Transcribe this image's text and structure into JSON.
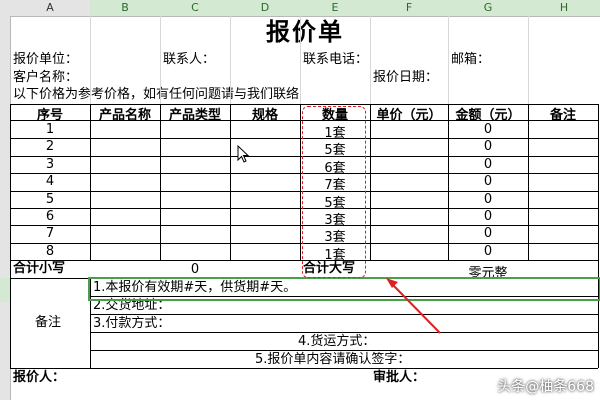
{
  "columns": [
    "A",
    "B",
    "C",
    "D",
    "E",
    "F",
    "G",
    "H"
  ],
  "title": "报价单",
  "info": {
    "quote_unit": "报价单位：",
    "contact": "联系人：",
    "phone": "联系电话：",
    "email": "邮箱：",
    "client": "客户名称：",
    "date": "报价日期：",
    "note": "以下价格为参考价格，如有任何问题请与我们联络"
  },
  "table": {
    "headers": [
      "序号",
      "产品名称",
      "产品类型",
      "规格",
      "数量",
      "单价（元）",
      "金额（元）",
      "备注"
    ],
    "rows": [
      {
        "no": "1",
        "qty": "1套",
        "amount": "0"
      },
      {
        "no": "2",
        "qty": "5套",
        "amount": "0"
      },
      {
        "no": "3",
        "qty": "6套",
        "amount": "0"
      },
      {
        "no": "4",
        "qty": "7套",
        "amount": "0"
      },
      {
        "no": "5",
        "qty": "5套",
        "amount": "0"
      },
      {
        "no": "6",
        "qty": "3套",
        "amount": "0"
      },
      {
        "no": "7",
        "qty": "3套",
        "amount": "0"
      },
      {
        "no": "8",
        "qty": "1套",
        "amount": "0"
      }
    ]
  },
  "totals": {
    "small_label": "合计小写",
    "small_value": "0",
    "big_label": "合计大写",
    "big_value": "零元整"
  },
  "remarks": {
    "label": "备注",
    "line1": "1.本报价有效期#天，供货期#天。",
    "line2": "2.交货地址：",
    "line3": "3.付款方式：",
    "line4": "4.货运方式：",
    "line5": "5.报价单内容请确认签字："
  },
  "footer": {
    "quoter": "报价人：",
    "approver": "审批人："
  },
  "watermark": "头条@柚条668",
  "colors": {
    "red_marker": "#e02020",
    "green_selection": "#4aa04a",
    "header_bg": "#e4e4e4"
  }
}
